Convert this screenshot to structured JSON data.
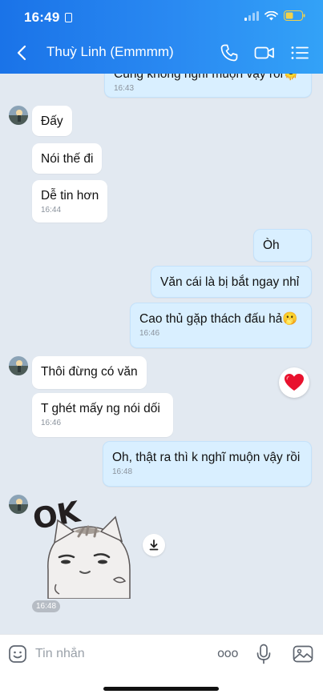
{
  "status_bar": {
    "time": "16:49"
  },
  "header": {
    "title": "Thuỳ Linh (Emmmm)"
  },
  "messages": [
    {
      "text": "Cũng không nghĩ muộn vậy rồi🫠",
      "time": "16:43"
    },
    {
      "text": "Đấy"
    },
    {
      "text": "Nói thế đi"
    },
    {
      "text": "Dễ tin hơn",
      "time": "16:44"
    },
    {
      "text": "Òh"
    },
    {
      "text": "Văn cái là bị bắt ngay nhỉ"
    },
    {
      "text": "Cao thủ gặp thách đấu hả🫢",
      "time": "16:46"
    },
    {
      "text": "Thôi đừng có văn"
    },
    {
      "text": "T ghét mấy ng nói dối",
      "time": "16:46"
    },
    {
      "text": "Oh, thật ra thì k nghĩ muộn vậy rồi",
      "time": "16:48"
    }
  ],
  "sticker": {
    "text": "OK",
    "time": "16:48"
  },
  "input": {
    "placeholder": "Tin nhắn",
    "more_label": "ooo"
  },
  "colors": {
    "header_start": "#1a73e8",
    "header_end": "#33a2f7",
    "outgoing_bubble": "#d9efff",
    "incoming_bubble": "#ffffff",
    "chat_background": "#e2e9f1",
    "reaction": "#e8112d"
  }
}
